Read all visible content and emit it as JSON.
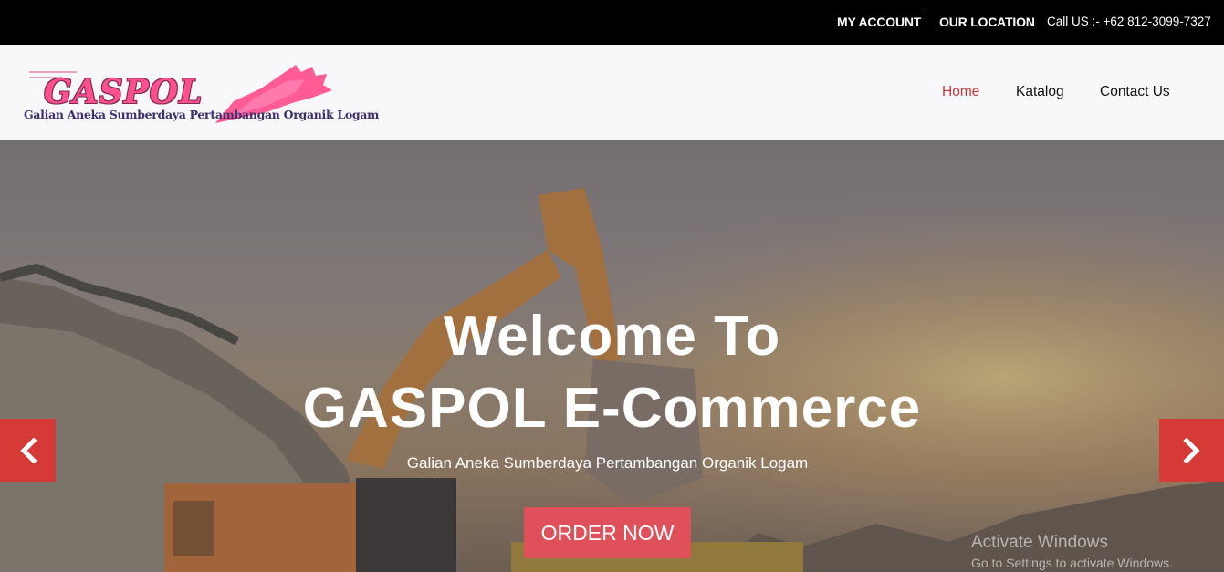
{
  "topbar": {
    "my_account": "MY ACCOUNT",
    "our_location": "OUR LOCATION",
    "call_us": "Call US :- +62 812-3099-7327"
  },
  "logo": {
    "name": "GASPOL",
    "tagline": "Galian Aneka Sumberdaya Pertambangan Organik Logam"
  },
  "nav": {
    "items": [
      {
        "label": "Home",
        "active": true
      },
      {
        "label": "Katalog",
        "active": false
      },
      {
        "label": "Contact Us",
        "active": false
      }
    ]
  },
  "hero": {
    "title_line1": "Welcome To",
    "title_line2": "GASPOL E-Commerce",
    "subtitle": "Galian Aneka Sumberdaya Pertambangan Organik Logam",
    "cta_label": "ORDER NOW",
    "prev_icon": "chevron-left-icon",
    "next_icon": "chevron-right-icon"
  },
  "watermark": {
    "line1": "Activate Windows",
    "line2": "Go to Settings to activate Windows."
  },
  "colors": {
    "topbar_bg": "#000000",
    "accent_red": "#d63a36",
    "cta": "#e0505a",
    "nav_active": "#c83a3a",
    "logo_pink": "#ff4f8d"
  }
}
